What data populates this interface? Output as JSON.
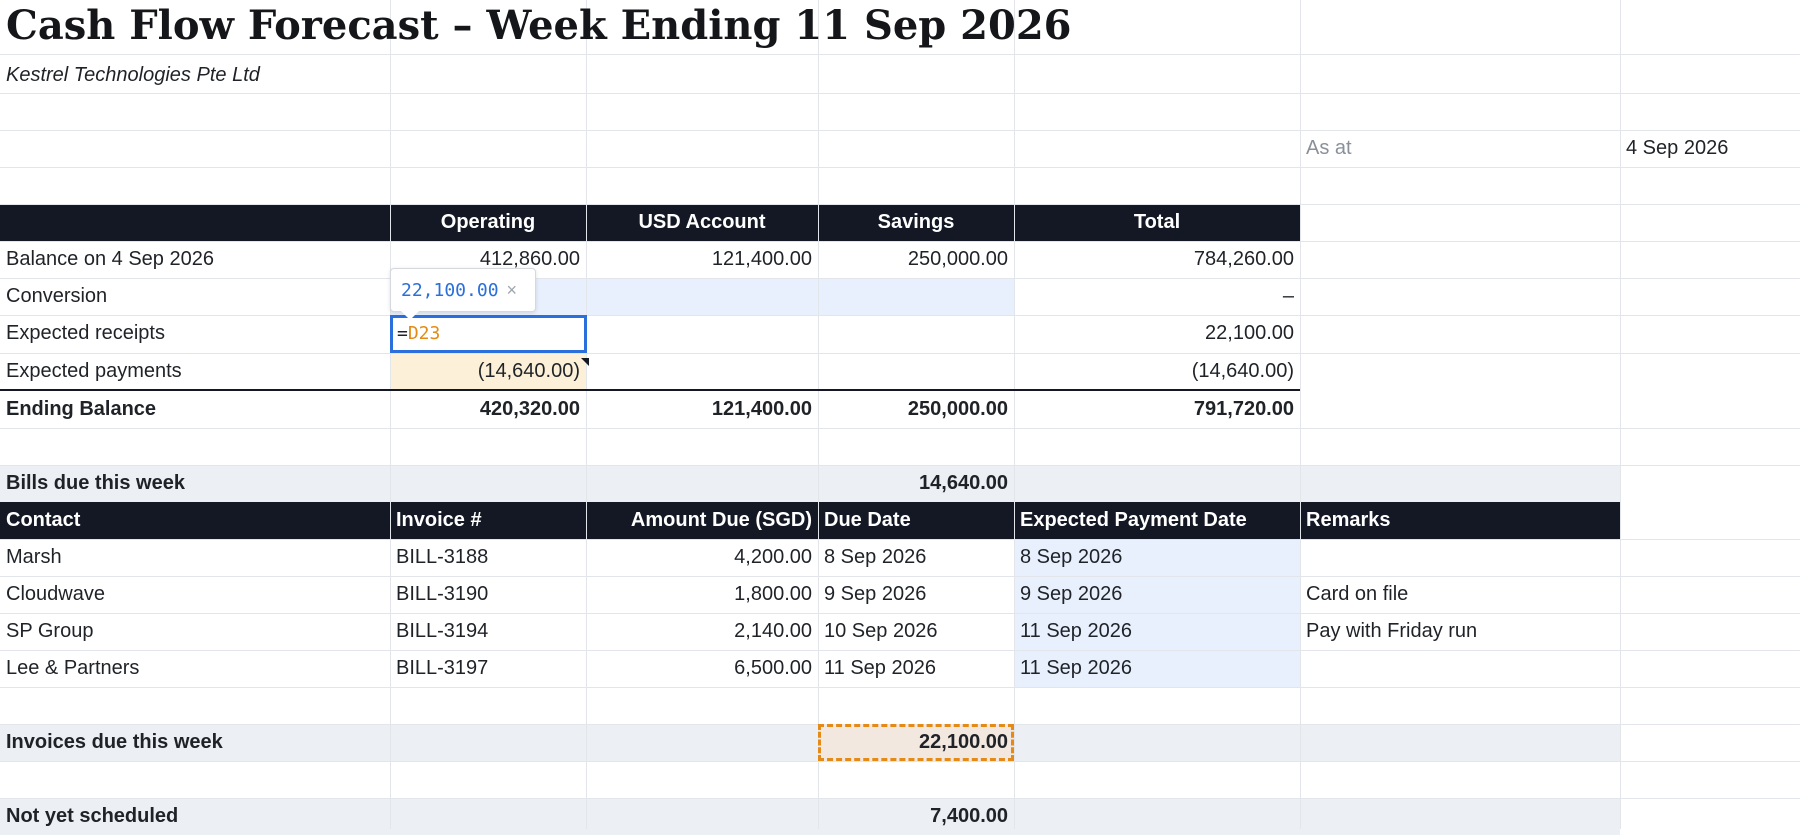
{
  "title": "Cash Flow Forecast – Week Ending 11 Sep 2026",
  "company": "Kestrel Technologies Pte Ltd",
  "as_at": {
    "label": "As at",
    "value": "4 Sep 2026"
  },
  "balance_table": {
    "headers": [
      "Operating",
      "USD Account",
      "Savings",
      "Total"
    ],
    "rows": [
      {
        "label": "Balance on 4 Sep 2026",
        "operating": "412,860.00",
        "usd": "121,400.00",
        "savings": "250,000.00",
        "total": "784,260.00"
      },
      {
        "label": "Conversion",
        "operating": "",
        "usd": "",
        "savings": "",
        "total": "–"
      },
      {
        "label": "Expected receipts",
        "operating": "=D23",
        "usd": "",
        "savings": "",
        "total": "22,100.00"
      },
      {
        "label": "Expected payments",
        "operating": "(14,640.00)",
        "usd": "",
        "savings": "",
        "total": "(14,640.00)"
      },
      {
        "label": "Ending Balance",
        "operating": "420,320.00",
        "usd": "121,400.00",
        "savings": "250,000.00",
        "total": "791,720.00"
      }
    ]
  },
  "formula_editor": {
    "eq": "=",
    "ref": "D23",
    "preview": "22,100.00",
    "close": "×"
  },
  "bills": {
    "section_label": "Bills due this week",
    "section_total": "14,640.00",
    "headers": [
      "Contact",
      "Invoice #",
      "Amount Due (SGD)",
      "Due Date",
      "Expected Payment Date",
      "Remarks"
    ],
    "rows": [
      {
        "contact": "Marsh",
        "invoice": "BILL-3188",
        "amount": "4,200.00",
        "due": "8 Sep 2026",
        "expected": "8 Sep 2026",
        "remarks": ""
      },
      {
        "contact": "Cloudwave",
        "invoice": "BILL-3190",
        "amount": "1,800.00",
        "due": "9 Sep 2026",
        "expected": "9 Sep 2026",
        "remarks": "Card on file"
      },
      {
        "contact": "SP Group",
        "invoice": "BILL-3194",
        "amount": "2,140.00",
        "due": "10 Sep 2026",
        "expected": "11 Sep 2026",
        "remarks": "Pay with Friday run"
      },
      {
        "contact": "Lee & Partners",
        "invoice": "BILL-3197",
        "amount": "6,500.00",
        "due": "11 Sep 2026",
        "expected": "11 Sep 2026",
        "remarks": ""
      }
    ]
  },
  "invoices": {
    "section_label": "Invoices due this week",
    "section_total": "22,100.00"
  },
  "unscheduled": {
    "section_label": "Not yet scheduled",
    "section_total": "7,400.00"
  }
}
